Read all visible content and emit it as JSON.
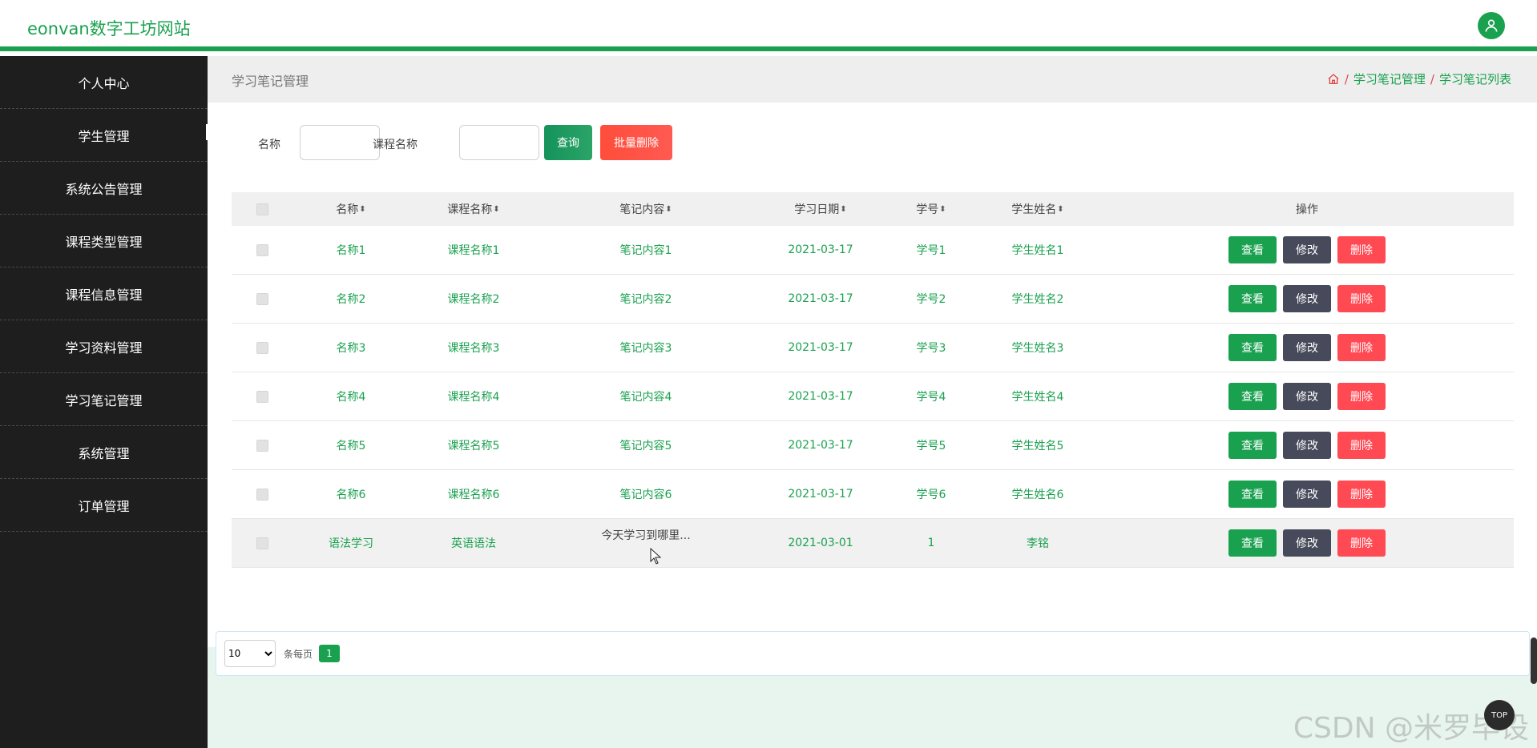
{
  "header": {
    "brand": "eonvan数字工坊网站"
  },
  "sidebar": {
    "items": [
      {
        "label": "个人中心"
      },
      {
        "label": "学生管理"
      },
      {
        "label": "系统公告管理"
      },
      {
        "label": "课程类型管理"
      },
      {
        "label": "课程信息管理"
      },
      {
        "label": "学习资料管理"
      },
      {
        "label": "学习笔记管理"
      },
      {
        "label": "系统管理"
      },
      {
        "label": "订单管理"
      }
    ]
  },
  "page": {
    "title": "学习笔记管理",
    "breadcrumb": [
      "学习笔记管理",
      "学习笔记列表"
    ],
    "crumb_sep": "/"
  },
  "search": {
    "name_label": "名称",
    "course_label": "课程名称",
    "name_value": "",
    "course_value": "",
    "query_btn": "查询",
    "batch_delete_btn": "批量删除"
  },
  "table": {
    "headers": {
      "name": "名称",
      "course": "课程名称",
      "content": "笔记内容",
      "date": "学习日期",
      "sid": "学号",
      "sname": "学生姓名",
      "ops": "操作"
    },
    "sort_glyph": "⬍",
    "rows": [
      {
        "name": "名称1",
        "course": "课程名称1",
        "content": "笔记内容1",
        "date": "2021-03-17",
        "sid": "学号1",
        "sname": "学生姓名1"
      },
      {
        "name": "名称2",
        "course": "课程名称2",
        "content": "笔记内容2",
        "date": "2021-03-17",
        "sid": "学号2",
        "sname": "学生姓名2"
      },
      {
        "name": "名称3",
        "course": "课程名称3",
        "content": "笔记内容3",
        "date": "2021-03-17",
        "sid": "学号3",
        "sname": "学生姓名3"
      },
      {
        "name": "名称4",
        "course": "课程名称4",
        "content": "笔记内容4",
        "date": "2021-03-17",
        "sid": "学号4",
        "sname": "学生姓名4"
      },
      {
        "name": "名称5",
        "course": "课程名称5",
        "content": "笔记内容5",
        "date": "2021-03-17",
        "sid": "学号5",
        "sname": "学生姓名5"
      },
      {
        "name": "名称6",
        "course": "课程名称6",
        "content": "笔记内容6",
        "date": "2021-03-17",
        "sid": "学号6",
        "sname": "学生姓名6"
      },
      {
        "name": "语法学习",
        "course": "英语语法",
        "content": "今天学习到哪里...",
        "date": "2021-03-01",
        "sid": "1",
        "sname": "李铭"
      }
    ],
    "actions": {
      "view": "查看",
      "edit": "修改",
      "delete": "删除"
    }
  },
  "pager": {
    "page_size": "10",
    "page_size_options": [
      "10"
    ],
    "per_page_label": "条每页",
    "current_page": "1"
  },
  "watermark": "CSDN @米罗毕设",
  "back_top_label": "TOP",
  "colors": {
    "accent": "#1aa14f",
    "danger": "#ff4a54",
    "edit": "#464a5a",
    "sidebar": "#1e1e1e"
  }
}
